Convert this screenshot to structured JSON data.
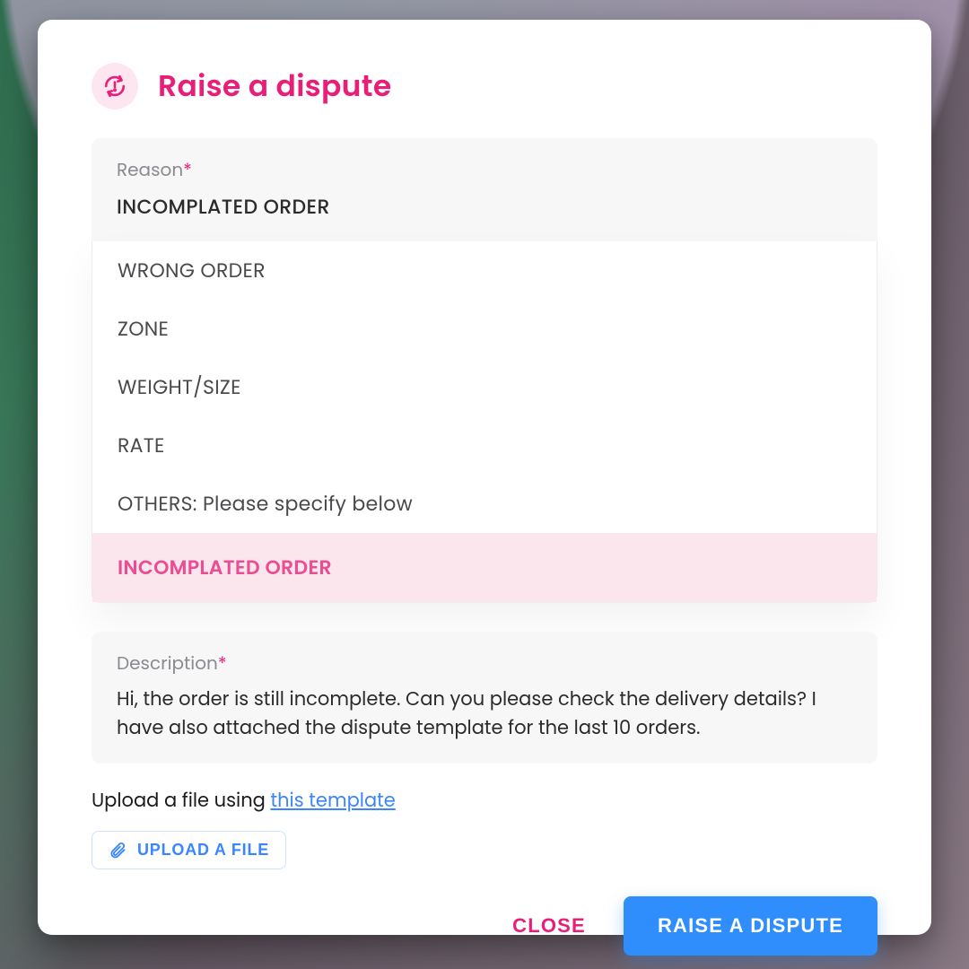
{
  "title": "Raise a dispute",
  "reason": {
    "label": "Reason",
    "required_mark": "*",
    "selected": "INCOMPLATED ORDER",
    "options": [
      "WRONG ORDER",
      "ZONE",
      "WEIGHT/SIZE",
      "RATE",
      "OTHERS: Please specify below",
      "INCOMPLATED ORDER"
    ]
  },
  "description": {
    "label": "Description",
    "required_mark": "*",
    "text": "Hi, the order is still incomplete. Can you please check the delivery details? I have also attached the dispute template for the last 10 orders."
  },
  "upload": {
    "line_prefix": "Upload a file using ",
    "template_link": "this template",
    "button": "UPLOAD A FILE"
  },
  "actions": {
    "close": "CLOSE",
    "submit": "RAISE A DISPUTE"
  }
}
